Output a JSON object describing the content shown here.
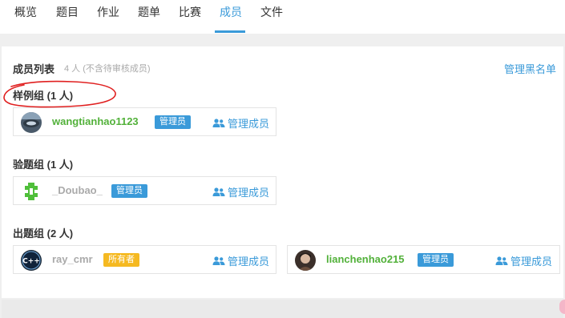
{
  "nav": {
    "tabs": [
      {
        "label": "概览"
      },
      {
        "label": "题目"
      },
      {
        "label": "作业"
      },
      {
        "label": "题单"
      },
      {
        "label": "比赛"
      },
      {
        "label": "成员"
      },
      {
        "label": "文件"
      }
    ],
    "active_tab": "成员"
  },
  "members": {
    "title": "成员列表",
    "subtitle": "4 人 (不含待审核成员)",
    "blacklist_label": "管理黑名单",
    "groups": [
      {
        "title": "样例组 (1 人)",
        "members": [
          {
            "name": "wangtianhao1123",
            "badge": "管理员",
            "manage": "管理成员"
          }
        ]
      },
      {
        "title": "验题组 (1 人)",
        "members": [
          {
            "name": "_Doubao_",
            "badge": "管理员",
            "manage": "管理成员"
          }
        ]
      },
      {
        "title": "出题组 (2 人)",
        "members": [
          {
            "name": "ray_cmr",
            "badge": "所有者",
            "manage": "管理成员"
          },
          {
            "name": "lianchenhao215",
            "badge": "管理员",
            "manage": "管理成员"
          }
        ]
      }
    ]
  },
  "colors": {
    "accent": "#3a9ad9",
    "green_name": "#52b13a",
    "gray_name": "#aaaaaa",
    "owner_badge": "#f5b921",
    "annotation_red": "#e02020"
  }
}
